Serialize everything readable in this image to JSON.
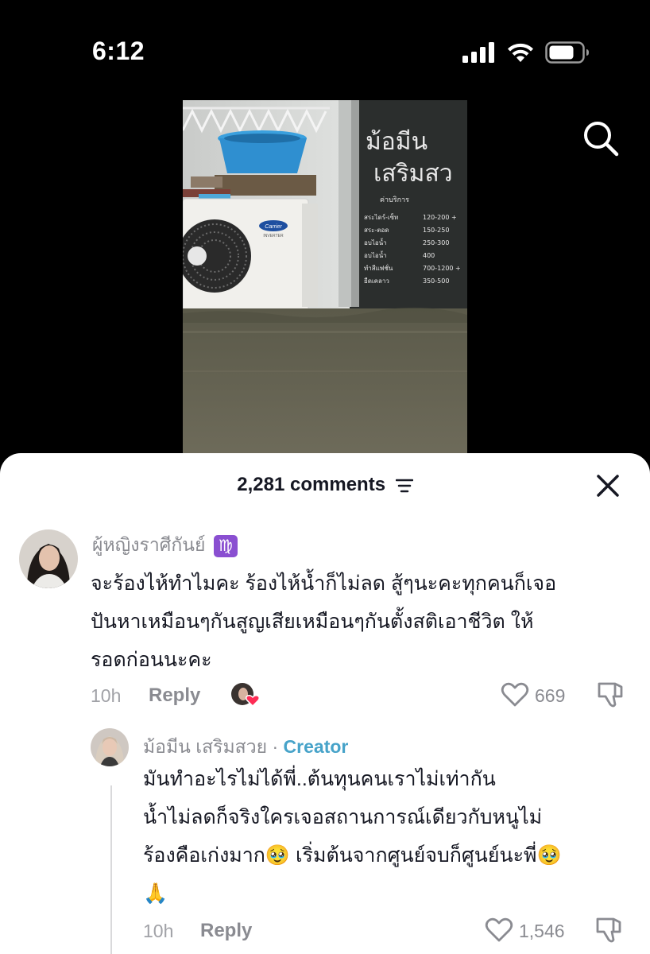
{
  "status_bar": {
    "time": "6:12",
    "icons": [
      "signal-bars-icon",
      "wifi-icon",
      "battery-icon"
    ]
  },
  "top_actions": {
    "search_icon": "search-icon"
  },
  "sheet": {
    "comment_count": "2,281 comments",
    "sort_icon": "sort-lines-icon",
    "close_icon": "close-icon"
  },
  "comments": [
    {
      "username": "ผู้หญิงราศีกันย์",
      "zodiac_badge": "♍",
      "lines": [
        "จะร้องไห้ทำไมคะ ร้องไห้น้ำก็ไม่ลด สู้ๆนะคะทุกคนก็เจอ",
        "ปันหาเหมือนๆกันสูญเสียเหมือนๆกันตั้งสติเอาชีวิต ให้",
        "รอดก่อนนะคะ"
      ],
      "time": "10h",
      "reply_label": "Reply",
      "likes": "669"
    }
  ],
  "replies": [
    {
      "username": "ม้อมีน เสริมสวย",
      "separator": " · ",
      "badge": "Creator",
      "lines": [
        "มันทำอะไรไม่ได้พี่..ต้นทุนคนเราไม่เท่ากัน",
        "น้ำไม่ลดก็จริงใครเจอสถานการณ์เดียวกับหนูไม่",
        "ร้องคือเก่งมาก🥹 เริ่มต้นจากศูนย์จบก็ศูนย์นะพี่🥹",
        "🙏"
      ],
      "time": "10h",
      "reply_label": "Reply",
      "likes": "1,546"
    }
  ],
  "video_scene": {
    "sign_title_1": "ม้อมีน",
    "sign_title_2": "เสริมสว",
    "price_heading": "ค่าบริการ",
    "price_rows": [
      {
        "item": "สระไดร์-เซ็ท",
        "price": "120-200 +"
      },
      {
        "item": "สระ-ตอด",
        "price": "150-250"
      },
      {
        "item": "อบไอน้ำ",
        "price": "250-300"
      },
      {
        "item": "อบไอน้ำ",
        "price": "400"
      },
      {
        "item": "ทำสีแฟชั่น",
        "price": "700-1200 +"
      },
      {
        "item": "ยืดเคลาว",
        "price": "350-500"
      }
    ],
    "ac_brand": "Carrier",
    "ac_sub": "INVERTER"
  }
}
